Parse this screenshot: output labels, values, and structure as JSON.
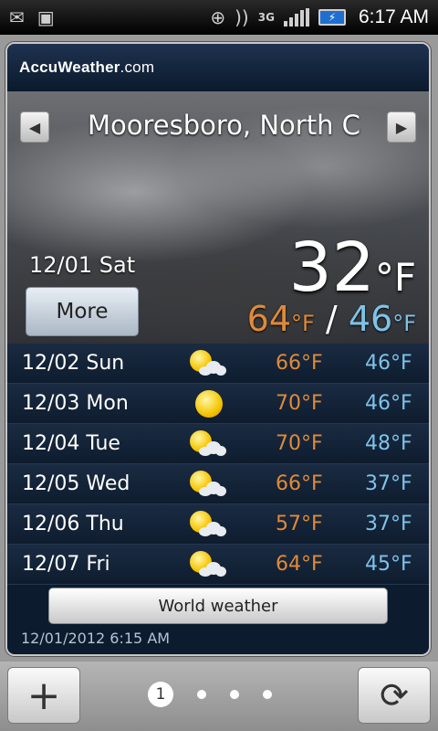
{
  "status_bar": {
    "time": "6:17 AM",
    "network": "3G",
    "icons": [
      "gmail-icon",
      "shopping-bag-icon",
      "sync-icon",
      "vibrate-icon",
      "network-3g-icon",
      "signal-icon",
      "battery-charging-icon"
    ]
  },
  "widget": {
    "brand_name": "AccuWeather",
    "brand_suffix": ".com",
    "location": "Mooresboro, North Car",
    "today_date": "12/01 Sat",
    "more_label": "More",
    "current_temp": "32",
    "current_unit": "°F",
    "high": "64",
    "low": "46",
    "hilo_unit": "°F",
    "hilo_separator": "/",
    "forecast": [
      {
        "date": "12/02 Sun",
        "icon": "partly-sunny-icon",
        "high": "66°F",
        "low": "46°F"
      },
      {
        "date": "12/03 Mon",
        "icon": "sunny-icon",
        "high": "70°F",
        "low": "46°F"
      },
      {
        "date": "12/04 Tue",
        "icon": "partly-sunny-icon",
        "high": "70°F",
        "low": "48°F"
      },
      {
        "date": "12/05 Wed",
        "icon": "partly-sunny-icon",
        "high": "66°F",
        "low": "37°F"
      },
      {
        "date": "12/06 Thu",
        "icon": "partly-sunny-icon",
        "high": "57°F",
        "low": "37°F"
      },
      {
        "date": "12/07 Fri",
        "icon": "partly-sunny-icon",
        "high": "64°F",
        "low": "45°F"
      }
    ],
    "world_weather_label": "World weather",
    "updated": "12/01/2012 6:15 AM"
  },
  "bottom_bar": {
    "add_label": "+",
    "refresh_label": "⟳",
    "current_page": "1",
    "total_pages": 4
  },
  "colors": {
    "high_temp": "#e08a38",
    "low_temp": "#7fc3e8",
    "widget_bg": "#0c1b2d"
  }
}
